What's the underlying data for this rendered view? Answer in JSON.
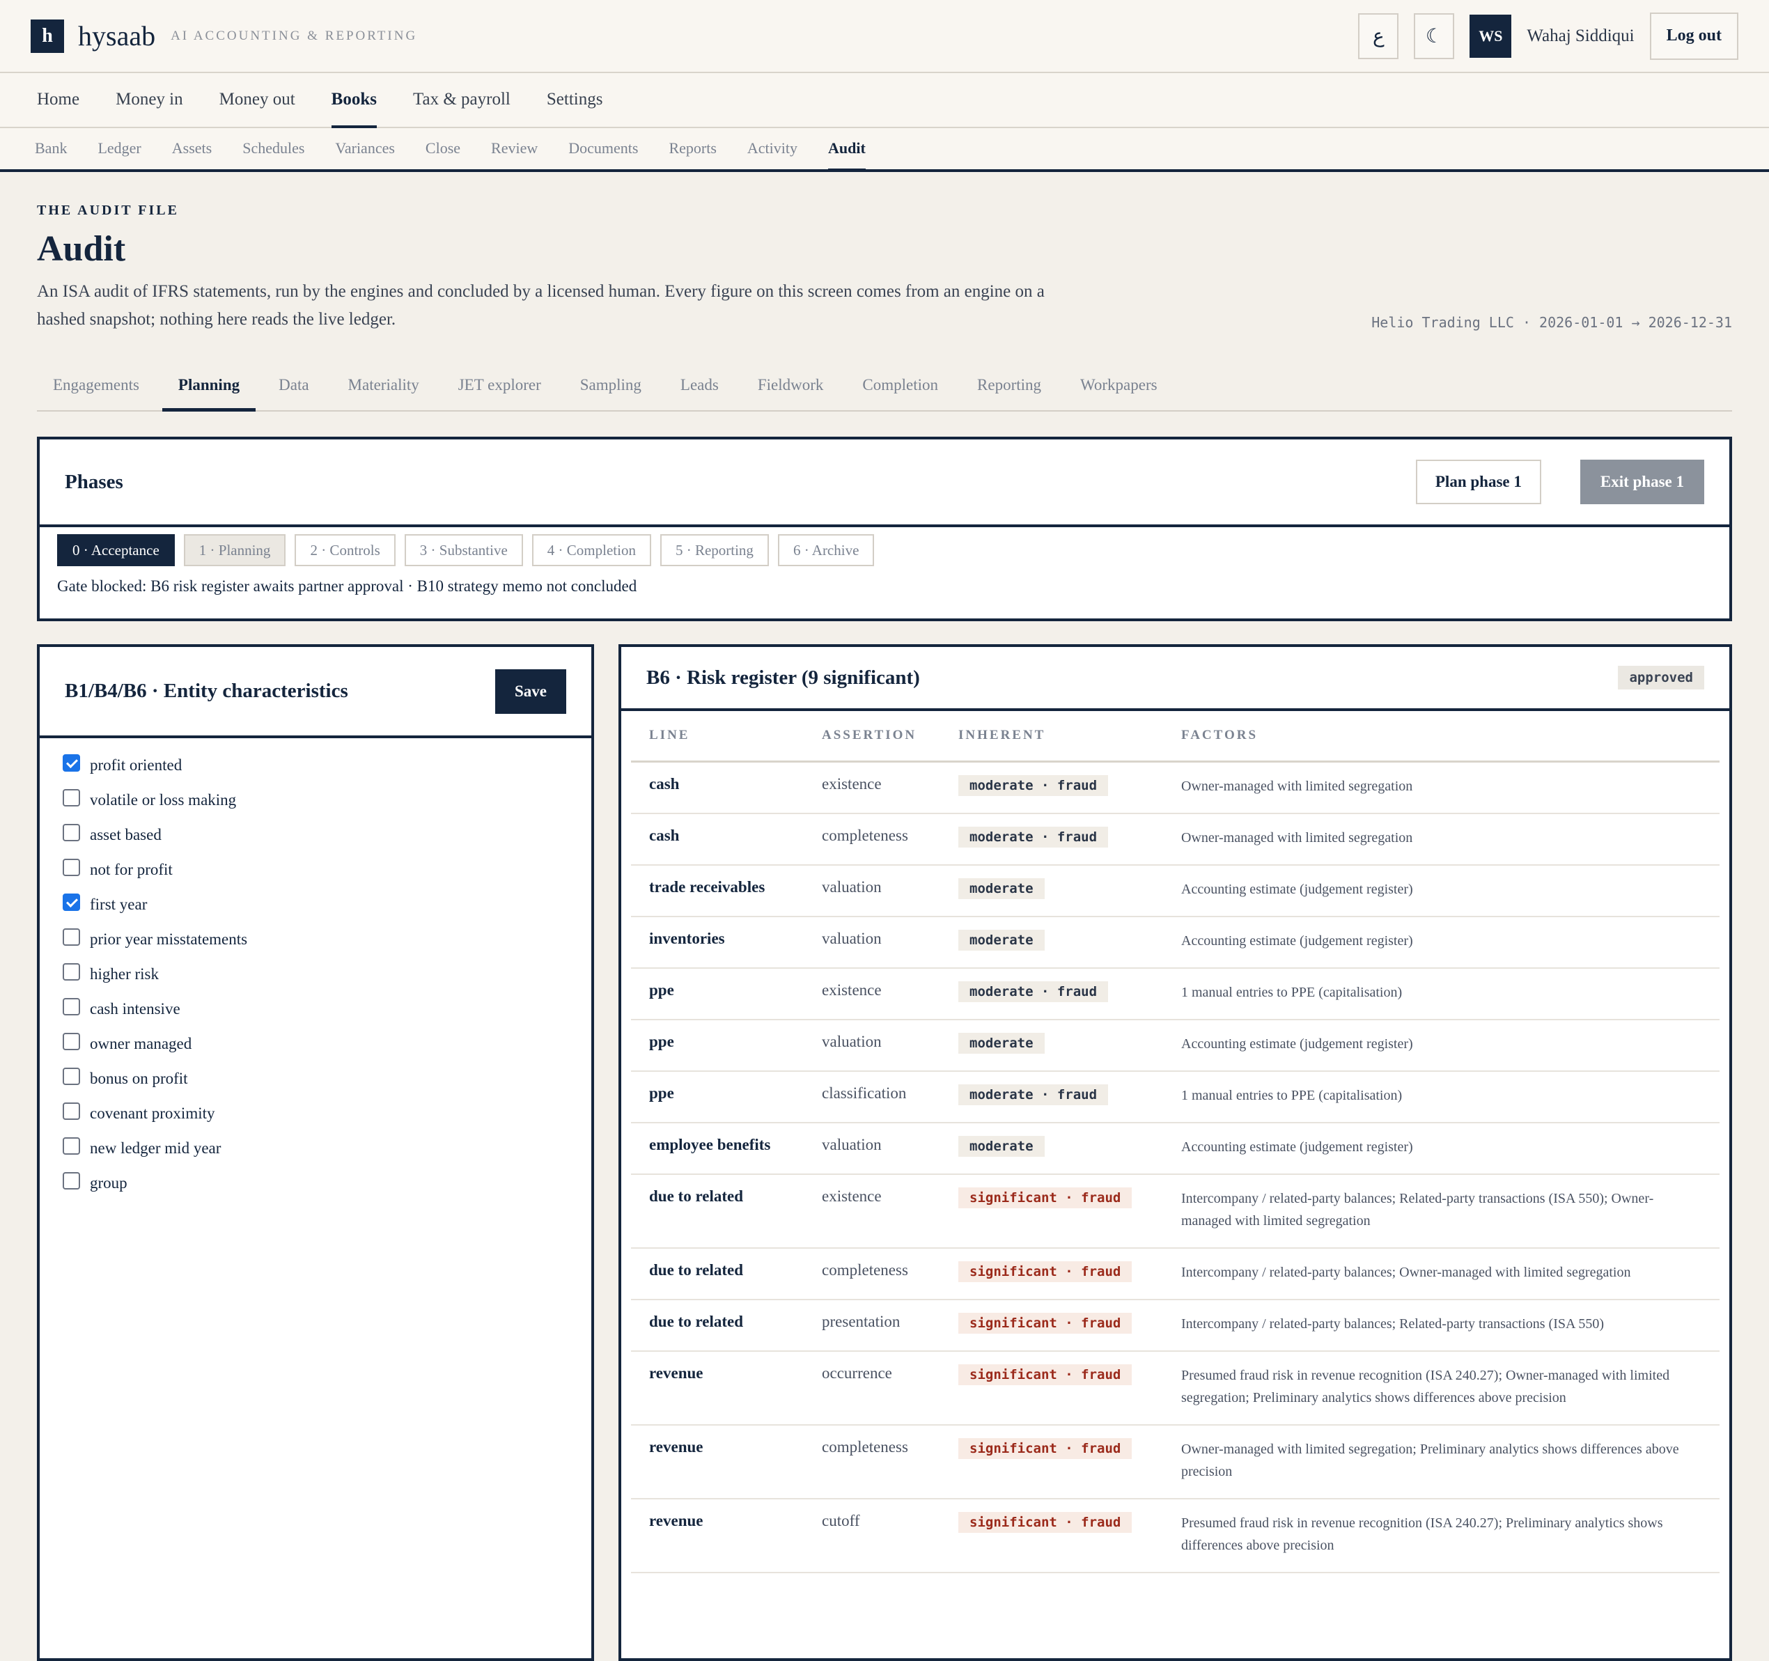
{
  "brand": {
    "mark": "h",
    "name": "hysaab",
    "tagline": "AI ACCOUNTING & REPORTING"
  },
  "topbar": {
    "lang_label": "ع",
    "theme_icon": "moon-icon",
    "theme_label": "☾",
    "avatar_initials": "WS",
    "username": "Wahaj Siddiqui",
    "logout_label": "Log out"
  },
  "main_nav": [
    {
      "label": "Home"
    },
    {
      "label": "Money in"
    },
    {
      "label": "Money out"
    },
    {
      "label": "Books"
    },
    {
      "label": "Tax & payroll"
    },
    {
      "label": "Settings"
    }
  ],
  "main_nav_active": "Books",
  "sub_nav": [
    {
      "label": "Bank"
    },
    {
      "label": "Ledger"
    },
    {
      "label": "Assets"
    },
    {
      "label": "Schedules"
    },
    {
      "label": "Variances"
    },
    {
      "label": "Close"
    },
    {
      "label": "Review"
    },
    {
      "label": "Documents"
    },
    {
      "label": "Reports"
    },
    {
      "label": "Activity"
    },
    {
      "label": "Audit"
    }
  ],
  "sub_nav_active": "Audit",
  "page": {
    "eyebrow": "THE AUDIT FILE",
    "title": "Audit",
    "intro": "An ISA audit of IFRS statements, run by the engines and concluded by a licensed human. Every figure on this screen comes from an engine on a hashed snapshot; nothing here reads the live ledger.",
    "entity_meta": "Helio Trading LLC · 2026-01-01 → 2026-12-31"
  },
  "tabs": [
    {
      "label": "Engagements"
    },
    {
      "label": "Planning"
    },
    {
      "label": "Data"
    },
    {
      "label": "Materiality"
    },
    {
      "label": "JET explorer"
    },
    {
      "label": "Sampling"
    },
    {
      "label": "Leads"
    },
    {
      "label": "Fieldwork"
    },
    {
      "label": "Completion"
    },
    {
      "label": "Reporting"
    },
    {
      "label": "Workpapers"
    }
  ],
  "tabs_active": "Planning",
  "phases": {
    "title": "Phases",
    "plan_label": "Plan phase 1",
    "exit_label": "Exit phase 1",
    "steps": [
      {
        "label": "0 · Acceptance"
      },
      {
        "label": "1 · Planning"
      },
      {
        "label": "2 · Controls"
      },
      {
        "label": "3 · Substantive"
      },
      {
        "label": "4 · Completion"
      },
      {
        "label": "5 · Reporting"
      },
      {
        "label": "6 · Archive"
      }
    ],
    "active_step": 0,
    "gate_message": "Gate blocked: B6 risk register awaits partner approval · B10 strategy memo not concluded"
  },
  "entity": {
    "title": "B1/B4/B6 · Entity characteristics",
    "save_label": "Save",
    "items": [
      {
        "label": "profit oriented",
        "checked": true
      },
      {
        "label": "volatile or loss making",
        "checked": false
      },
      {
        "label": "asset based",
        "checked": false
      },
      {
        "label": "not for profit",
        "checked": false
      },
      {
        "label": "first year",
        "checked": true
      },
      {
        "label": "prior year misstatements",
        "checked": false
      },
      {
        "label": "higher risk",
        "checked": false
      },
      {
        "label": "cash intensive",
        "checked": false
      },
      {
        "label": "owner managed",
        "checked": false
      },
      {
        "label": "bonus on profit",
        "checked": false
      },
      {
        "label": "covenant proximity",
        "checked": false
      },
      {
        "label": "new ledger mid year",
        "checked": false
      },
      {
        "label": "group",
        "checked": false
      }
    ]
  },
  "register": {
    "title": "B6 · Risk register (9 significant)",
    "status": "approved",
    "columns": [
      "LINE",
      "ASSERTION",
      "INHERENT",
      "FACTORS"
    ],
    "rows": [
      {
        "line": "cash",
        "assertion": "existence",
        "inherent": "moderate · fraud",
        "significant": false,
        "factors": "Owner-managed with limited segregation"
      },
      {
        "line": "cash",
        "assertion": "completeness",
        "inherent": "moderate · fraud",
        "significant": false,
        "factors": "Owner-managed with limited segregation"
      },
      {
        "line": "trade receivables",
        "assertion": "valuation",
        "inherent": "moderate",
        "significant": false,
        "factors": "Accounting estimate (judgement register)"
      },
      {
        "line": "inventories",
        "assertion": "valuation",
        "inherent": "moderate",
        "significant": false,
        "factors": "Accounting estimate (judgement register)"
      },
      {
        "line": "ppe",
        "assertion": "existence",
        "inherent": "moderate · fraud",
        "significant": false,
        "factors": "1 manual entries to PPE (capitalisation)"
      },
      {
        "line": "ppe",
        "assertion": "valuation",
        "inherent": "moderate",
        "significant": false,
        "factors": "Accounting estimate (judgement register)"
      },
      {
        "line": "ppe",
        "assertion": "classification",
        "inherent": "moderate · fraud",
        "significant": false,
        "factors": "1 manual entries to PPE (capitalisation)"
      },
      {
        "line": "employee benefits",
        "assertion": "valuation",
        "inherent": "moderate",
        "significant": false,
        "factors": "Accounting estimate (judgement register)"
      },
      {
        "line": "due to related",
        "assertion": "existence",
        "inherent": "significant · fraud",
        "significant": true,
        "factors": "Intercompany / related-party balances; Related-party transactions (ISA 550); Owner-managed with limited segregation"
      },
      {
        "line": "due to related",
        "assertion": "completeness",
        "inherent": "significant · fraud",
        "significant": true,
        "factors": "Intercompany / related-party balances; Owner-managed with limited segregation"
      },
      {
        "line": "due to related",
        "assertion": "presentation",
        "inherent": "significant · fraud",
        "significant": true,
        "factors": "Intercompany / related-party balances; Related-party transactions (ISA 550)"
      },
      {
        "line": "revenue",
        "assertion": "occurrence",
        "inherent": "significant · fraud",
        "significant": true,
        "factors": "Presumed fraud risk in revenue recognition (ISA 240.27); Owner-managed with limited segregation; Preliminary analytics shows differences above precision"
      },
      {
        "line": "revenue",
        "assertion": "completeness",
        "inherent": "significant · fraud",
        "significant": true,
        "factors": "Owner-managed with limited segregation; Preliminary analytics shows differences above precision"
      },
      {
        "line": "revenue",
        "assertion": "cutoff",
        "inherent": "significant · fraud",
        "significant": true,
        "factors": "Presumed fraud risk in revenue recognition (ISA 240.27); Preliminary analytics shows differences above precision"
      }
    ]
  },
  "colors": {
    "navy": "#14253d",
    "significant": "#9b2a1b",
    "checkbox": "#1a73e8"
  }
}
